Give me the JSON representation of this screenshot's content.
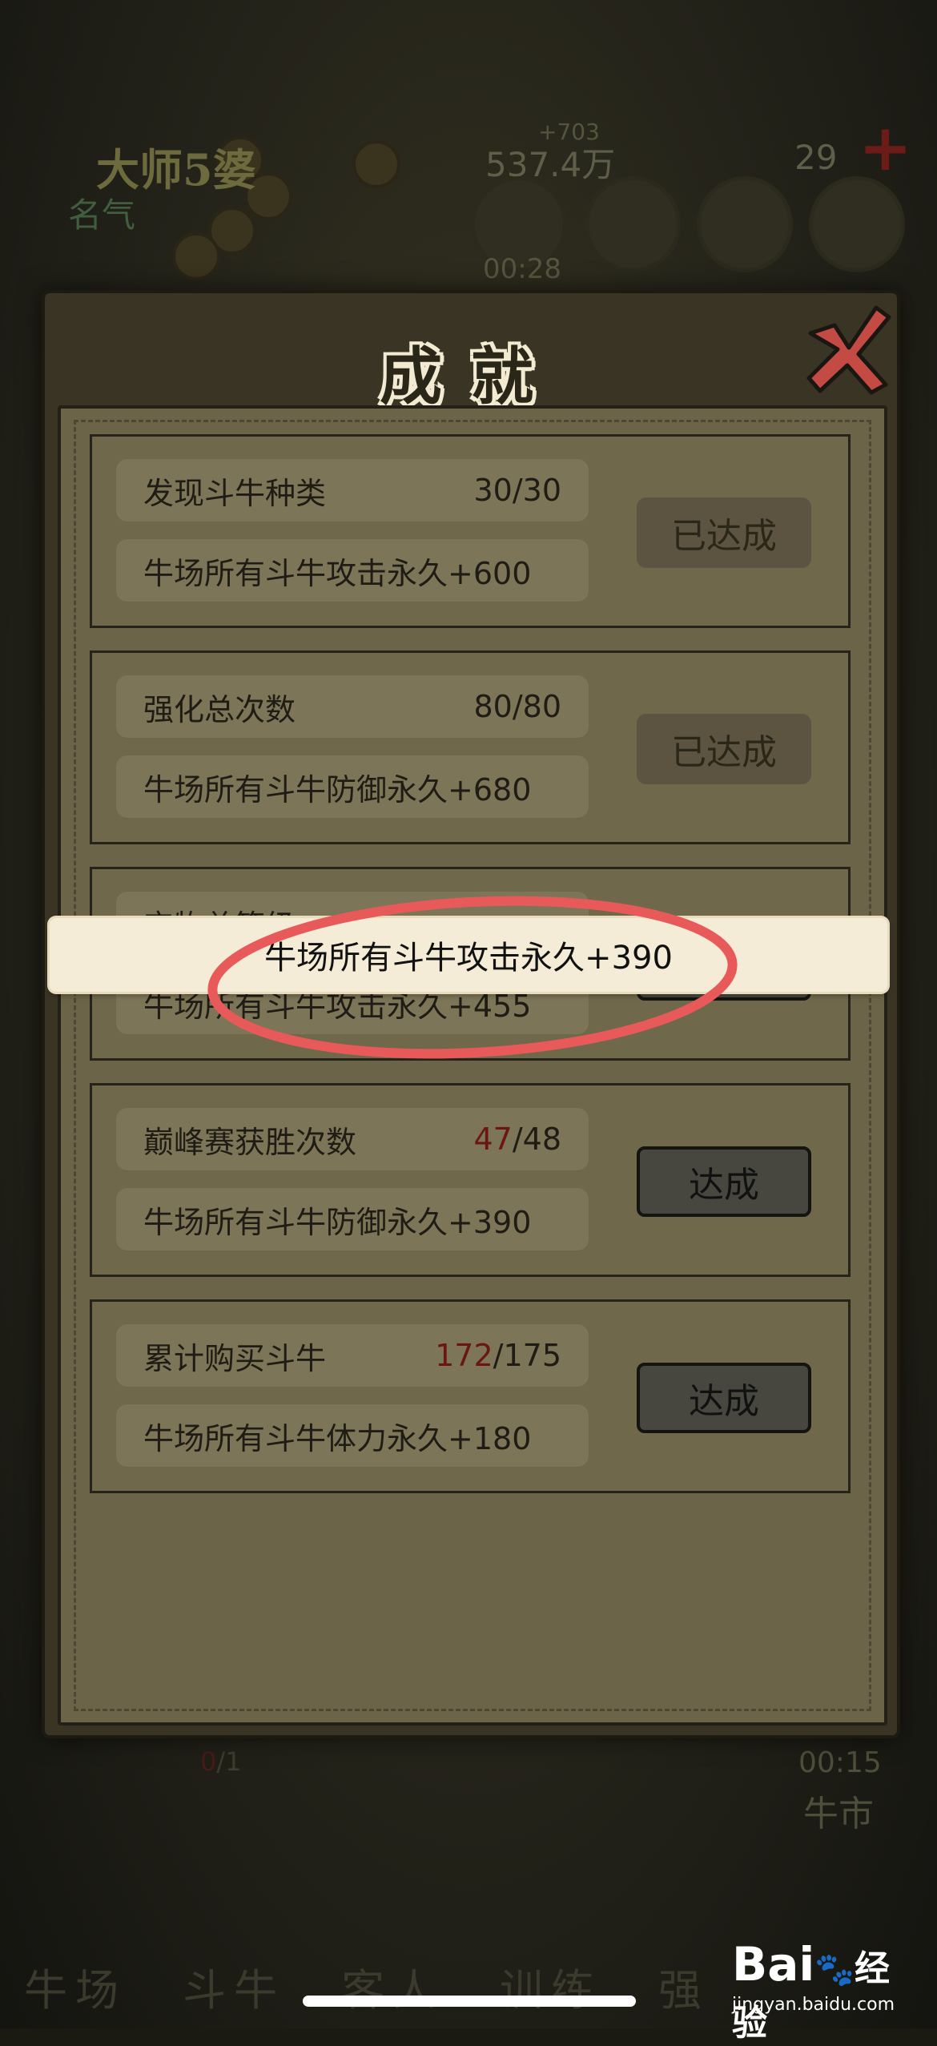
{
  "hud": {
    "player_name": "大师5婆",
    "fame_label": "名气",
    "money_delta": "+703",
    "money": "537.4万",
    "gems": "29",
    "timer": "00:28"
  },
  "dialog": {
    "title": "成就",
    "close_icon": "close-x-icon"
  },
  "achievements": [
    {
      "name": "发现斗牛种类",
      "progress_current": "30",
      "progress_total": "/30",
      "current_highlight": false,
      "reward": "牛场所有斗牛攻击永久+600",
      "status": "已达成",
      "achieved": true
    },
    {
      "name": "强化总次数",
      "progress_current": "80",
      "progress_total": "/80",
      "current_highlight": false,
      "reward": "牛场所有斗牛防御永久+680",
      "status": "已达成",
      "achieved": true
    },
    {
      "name": "宝物总等级",
      "progress_current": "",
      "progress_total": "",
      "current_highlight": false,
      "reward": "牛场所有斗牛攻击永久+455",
      "status": "",
      "achieved": false
    },
    {
      "name": "巅峰赛获胜次数",
      "progress_current": "47",
      "progress_total": "/48",
      "current_highlight": true,
      "reward": "牛场所有斗牛防御永久+390",
      "status": "达成",
      "achieved": false
    },
    {
      "name": "累计购买斗牛",
      "progress_current": "172",
      "progress_total": "/175",
      "current_highlight": true,
      "reward": "牛场所有斗牛体力永久+180",
      "status": "达成",
      "achieved": false
    }
  ],
  "toast": {
    "message": "牛场所有斗牛攻击永久+390"
  },
  "bottom": {
    "count_current": "0",
    "count_total": "/1",
    "timer": "00:15",
    "market": "牛市",
    "nav": [
      "牛场",
      "斗牛",
      "客人",
      "训练",
      "强"
    ]
  },
  "watermark": {
    "brand": "Bai",
    "brand_suffix": "经验",
    "url": "jingyan.baidu.com"
  },
  "colors": {
    "annotation_ring": "#e85a5a",
    "progress_highlight": "#6b1612",
    "toast_bg": "#f4ecd6"
  }
}
